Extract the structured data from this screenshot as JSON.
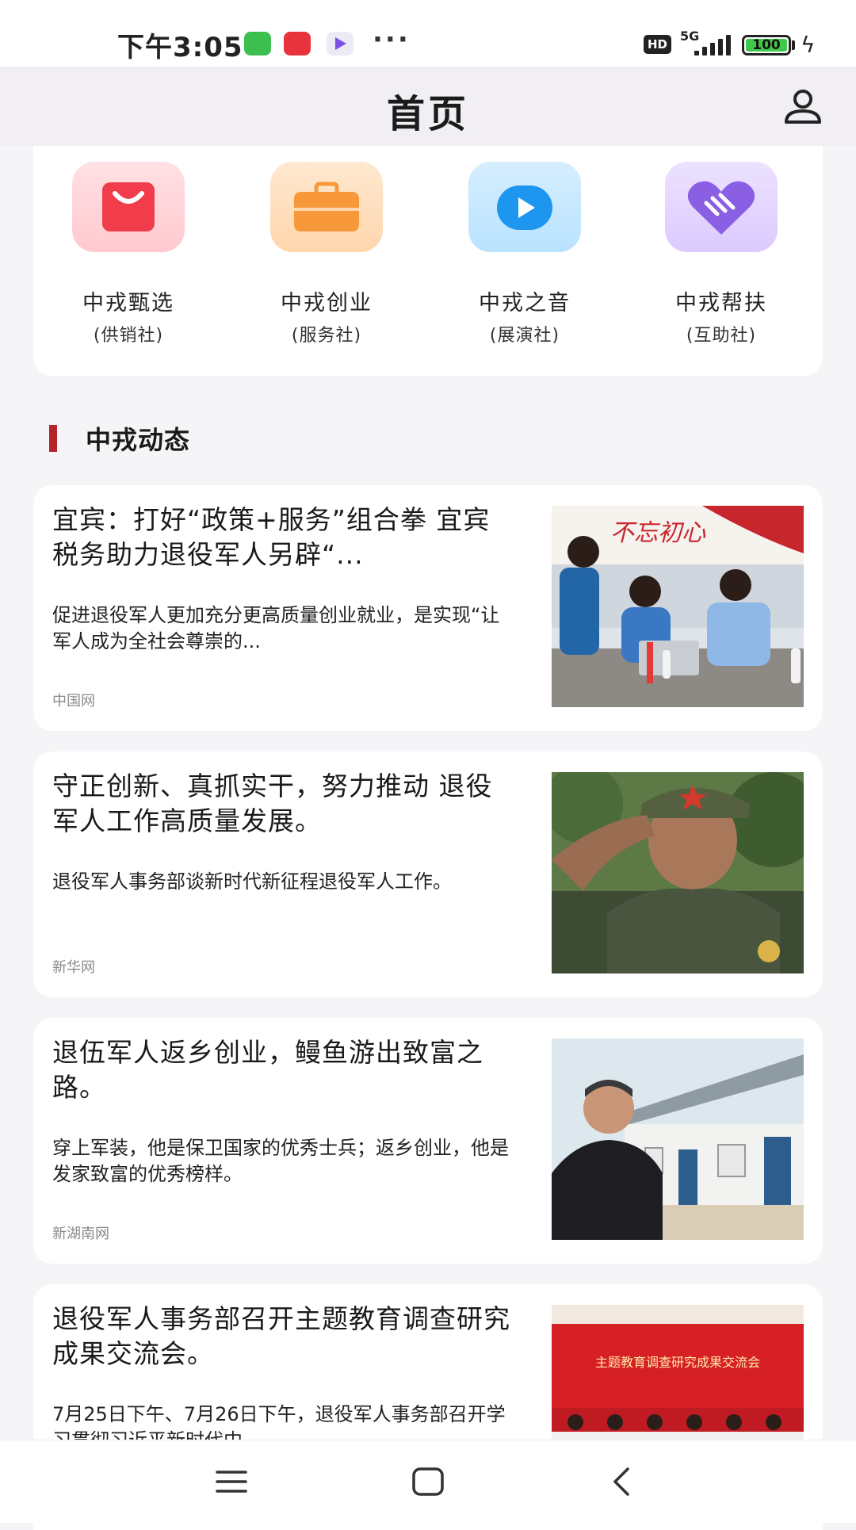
{
  "status_bar": {
    "time": "下午3:05",
    "more": "···",
    "hd_label": "HD",
    "network": "5G",
    "battery": "100"
  },
  "header": {
    "title": "首页"
  },
  "quick_links": [
    {
      "name": "中戎甄选",
      "sub": "(供销社)",
      "icon": "shopping-bag-icon",
      "color": "#f13c4c"
    },
    {
      "name": "中戎创业",
      "sub": "(服务社)",
      "icon": "briefcase-icon",
      "color": "#f7993a"
    },
    {
      "name": "中戎之音",
      "sub": "(展演社)",
      "icon": "video-play-icon",
      "color": "#1c96ef"
    },
    {
      "name": "中戎帮扶",
      "sub": "(互助社)",
      "icon": "handshake-heart-icon",
      "color": "#8b5fe3"
    }
  ],
  "section": {
    "title": "中戎动态",
    "accent": "#b7232b"
  },
  "news": [
    {
      "title": "宜宾：打好“政策+服务”组合拳 宜宾税务助力退役军人另辟“...",
      "summary": "促进退役军人更加充分更高质量创业就业，是实现“让军人成为全社会尊崇的...",
      "source": "中国网",
      "image_text": "不忘初心"
    },
    {
      "title": "守正创新、真抓实干，努力推动 退役军人工作高质量发展。",
      "summary": "退役军人事务部谈新时代新征程退役军人工作。",
      "source": "新华网"
    },
    {
      "title": "退伍军人返乡创业，鳗鱼游出致富之路。",
      "summary": "穿上军装，他是保卫国家的优秀士兵；返乡创业，他是发家致富的优秀榜样。",
      "source": "新湖南网"
    },
    {
      "title": "退役军人事务部召开主题教育调查研究成果交流会。",
      "summary": "7月25日下午、7月26日下午，退役军人事务部召开学习贯彻习近平新时代中",
      "source": "",
      "image_text": "主题教育调查研究成果交流会"
    }
  ]
}
